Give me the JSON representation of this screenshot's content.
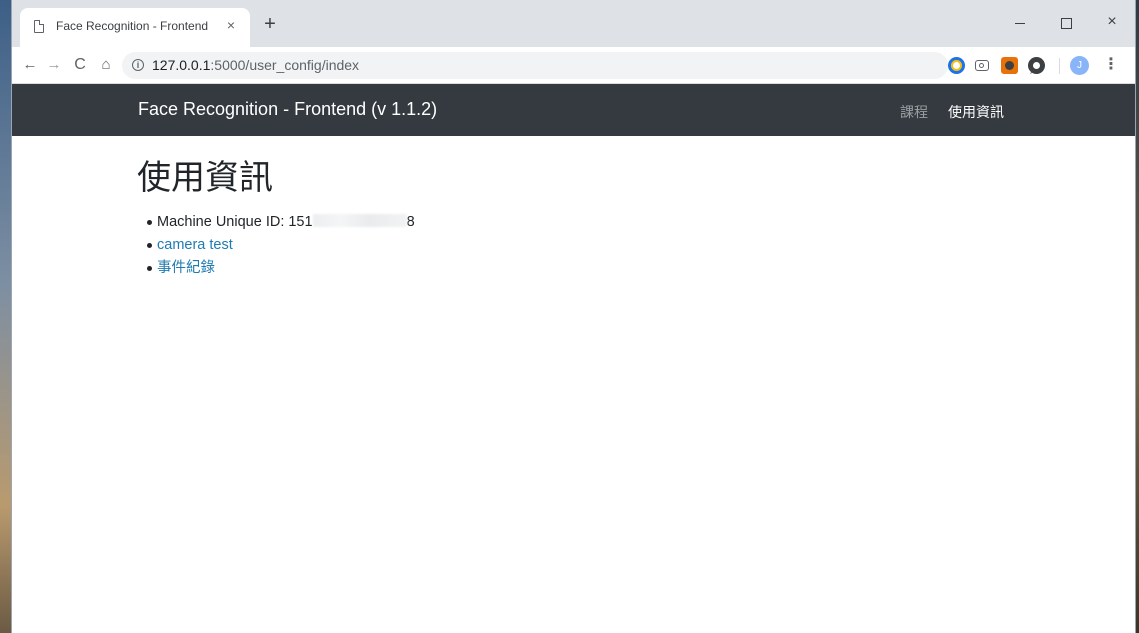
{
  "browser": {
    "tab": {
      "title": "Face Recognition - Frontend",
      "close_glyph": "×"
    },
    "new_tab_glyph": "+",
    "window_controls": {
      "minimize": "minimize",
      "maximize": "maximize",
      "close_glyph": "×"
    },
    "toolbar": {
      "back_glyph": "←",
      "forward_glyph": "→",
      "reload_glyph": "C",
      "home_glyph": "⌂",
      "url_host": "127.0.0.1",
      "url_path": ":5000/user_config/index",
      "star_glyph": "☆",
      "extensions": [
        "extension-chrome-icon",
        "extension-camera-icon",
        "extension-orange-icon",
        "extension-dark-icon"
      ],
      "avatar_initial": "J",
      "menu_glyph": "⋮"
    }
  },
  "navbar": {
    "brand": "Face Recognition - Frontend (v 1.1.2)",
    "links": [
      "課程",
      "使用資訊"
    ]
  },
  "content": {
    "heading": "使用資訊",
    "machine_id_label": "Machine Unique ID: 151",
    "machine_id_tail": "8",
    "camera_link": "camera test",
    "event_link": "事件紀錄"
  },
  "colors": {
    "navbar_bg": "#343a40",
    "link": "#1f7bb1",
    "tabstrip_bg": "#dee1e6"
  }
}
